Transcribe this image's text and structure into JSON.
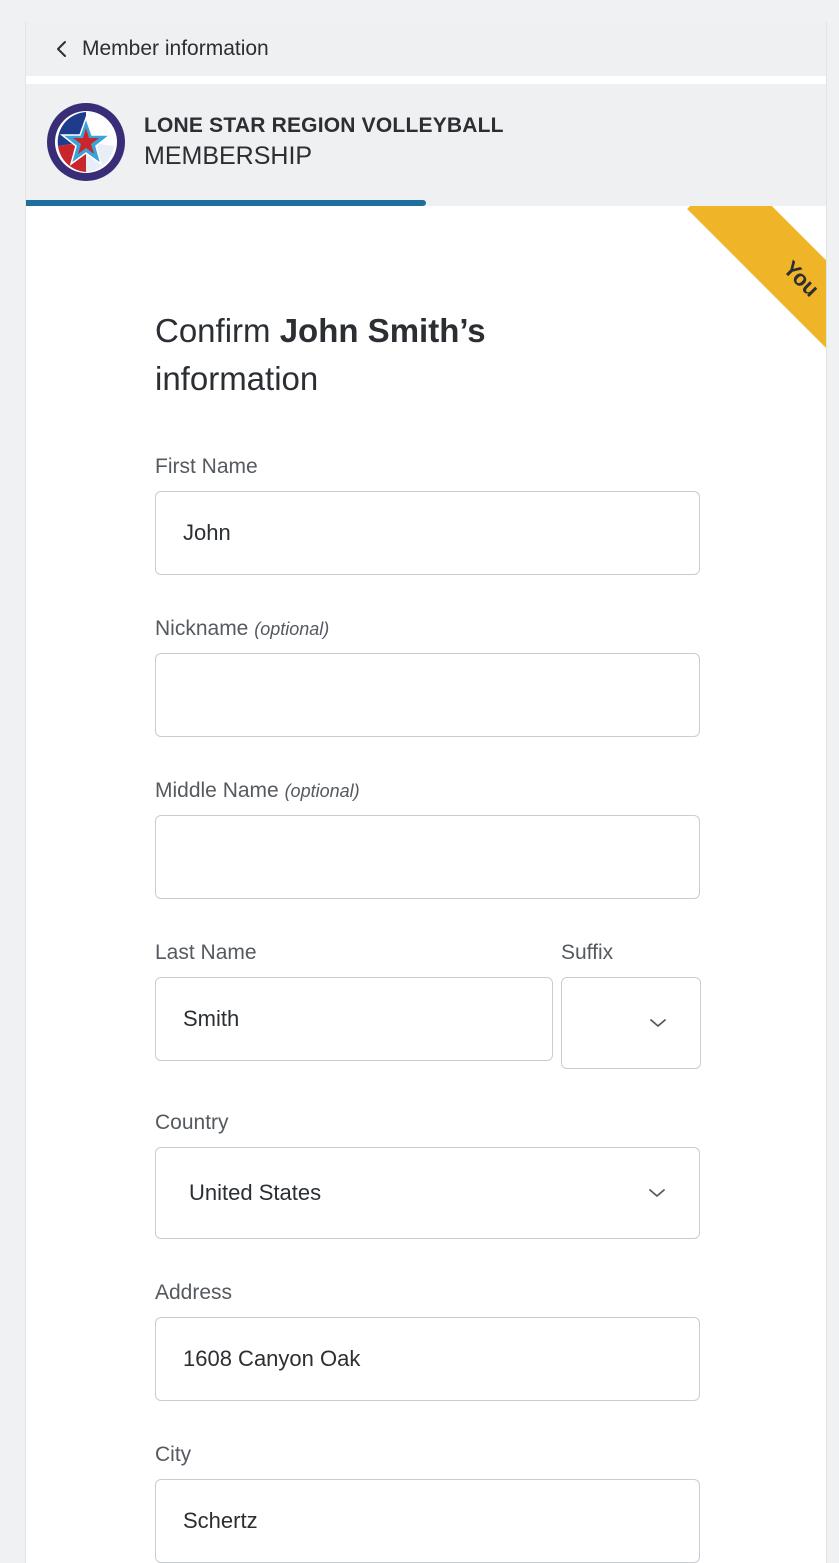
{
  "topbar": {
    "back_label": "Member information"
  },
  "header": {
    "org_name": "LONE STAR REGION VOLLEYBALL",
    "subtitle": "MEMBERSHIP",
    "logo_text": "LONE STAR REGION VOLLEYBALL"
  },
  "progress": {
    "fraction": 0.5
  },
  "ribbon": {
    "label": "You"
  },
  "form": {
    "headline_prefix": "Confirm ",
    "headline_name": "John Smith’s",
    "headline_suffix": "information",
    "first_name": {
      "label": "First Name",
      "value": "John"
    },
    "nickname": {
      "label": "Nickname",
      "optional": "(optional)",
      "value": ""
    },
    "middle_name": {
      "label": "Middle Name",
      "optional": "(optional)",
      "value": ""
    },
    "last_name": {
      "label": "Last Name",
      "value": "Smith"
    },
    "suffix": {
      "label": "Suffix",
      "value": ""
    },
    "country": {
      "label": "Country",
      "value": "United States"
    },
    "address": {
      "label": "Address",
      "value": "1608 Canyon Oak"
    },
    "city": {
      "label": "City",
      "value": "Schertz"
    }
  },
  "colors": {
    "accent": "#1e6fa0",
    "ribbon": "#f0b429",
    "logo_ring": "#3a2d78"
  }
}
